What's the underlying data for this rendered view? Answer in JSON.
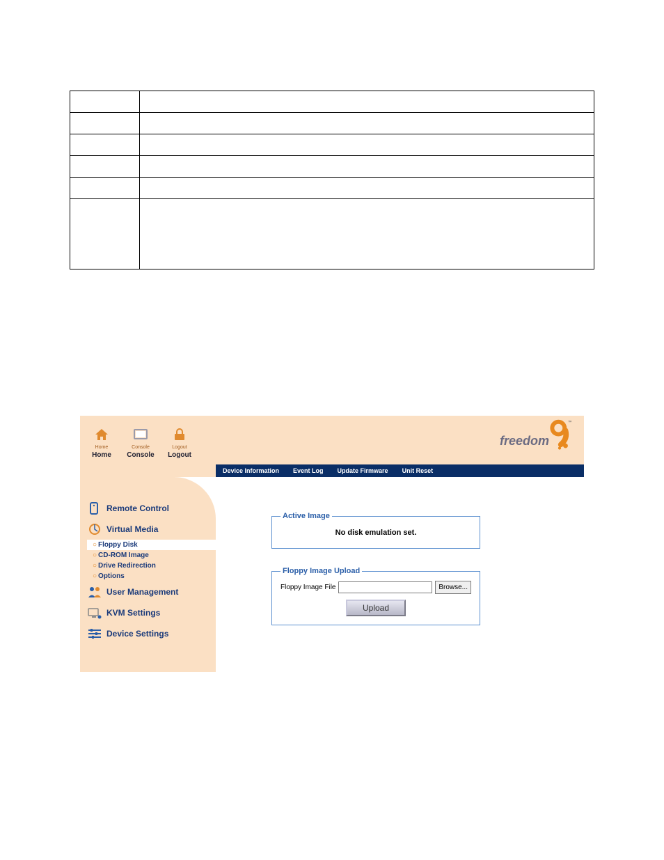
{
  "toolbar": {
    "home": {
      "small": "Home",
      "main": "Home"
    },
    "console": {
      "small": "Console",
      "main": "Console"
    },
    "logout": {
      "small": "Logout",
      "main": "Logout"
    }
  },
  "logo": {
    "brand": "freedom",
    "suffix_glyph": "9",
    "tm": "™"
  },
  "nav": {
    "device_info": "Device Information",
    "event_log": "Event Log",
    "update_firmware": "Update Firmware",
    "unit_reset": "Unit Reset"
  },
  "sidebar": {
    "remote_control": "Remote Control",
    "virtual_media": "Virtual Media",
    "subs": {
      "floppy": "Floppy Disk",
      "cdrom": "CD-ROM Image",
      "drive_redir": "Drive Redirection",
      "options": "Options"
    },
    "user_mgmt": "User Management",
    "kvm": "KVM Settings",
    "device": "Device Settings"
  },
  "panels": {
    "active_image": {
      "legend": "Active Image",
      "status": "No disk emulation set."
    },
    "upload": {
      "legend": "Floppy Image Upload",
      "file_label": "Floppy Image File",
      "browse": "Browse...",
      "upload": "Upload"
    }
  }
}
